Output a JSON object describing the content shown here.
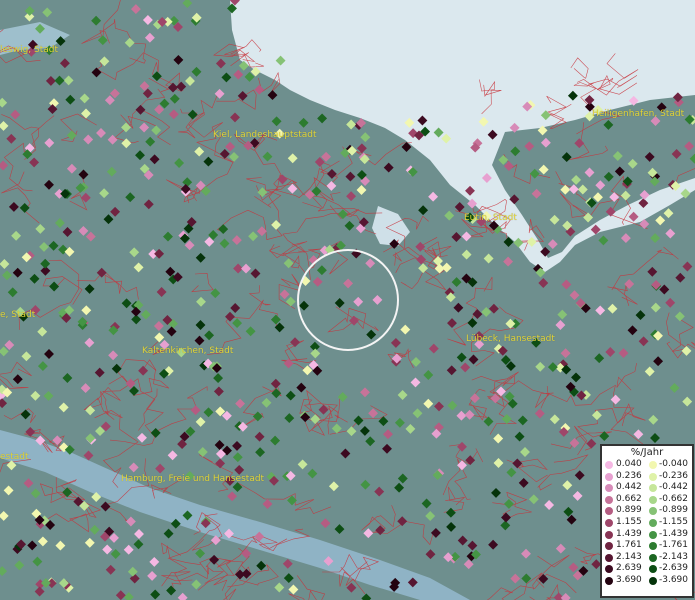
{
  "map": {
    "colors": {
      "land": "#6e8f8e",
      "water": "#dbe8ee",
      "river": "#8fb3c5",
      "borders": "#c8323a",
      "label": "#e0d43a"
    },
    "cities": [
      {
        "id": "schleswig",
        "name": "leswig, Stadt"
      },
      {
        "id": "kiel",
        "name": "Kiel, Landeshauptstadt"
      },
      {
        "id": "heiligenhafen",
        "name": "Heiligenhafen, Stadt"
      },
      {
        "id": "eutin",
        "name": "Eutin, Stadt"
      },
      {
        "id": "luebeck",
        "name": "Lübeck, Hansestadt"
      },
      {
        "id": "west",
        "name": "e, Stadt"
      },
      {
        "id": "kaltenkirchen",
        "name": "Kaltenkirchen, Stadt"
      },
      {
        "id": "stade",
        "name": "estadt"
      },
      {
        "id": "hamburg",
        "name": "Hamburg, Freie und Hansestadt"
      }
    ]
  },
  "legend": {
    "title": "%/Jahr",
    "rows": [
      {
        "pos": "0.040",
        "neg": "-0.040",
        "pc": "#f5b8e3",
        "nc": "#f2f7b0"
      },
      {
        "pos": "0.236",
        "neg": "-0.236",
        "pc": "#e7a0d0",
        "nc": "#dff2a8"
      },
      {
        "pos": "0.442",
        "neg": "-0.442",
        "pc": "#d78bb8",
        "nc": "#c6e69a"
      },
      {
        "pos": "0.662",
        "neg": "-0.662",
        "pc": "#c77399",
        "nc": "#a8d78a"
      },
      {
        "pos": "0.899",
        "neg": "-0.899",
        "pc": "#b55c82",
        "nc": "#86c275"
      },
      {
        "pos": "1.155",
        "neg": "-1.155",
        "pc": "#9f466a",
        "nc": "#63ab5c"
      },
      {
        "pos": "1.439",
        "neg": "-1.439",
        "pc": "#883454",
        "nc": "#449444"
      },
      {
        "pos": "1.761",
        "neg": "-1.761",
        "pc": "#702441",
        "nc": "#2d7c30"
      },
      {
        "pos": "2.143",
        "neg": "-2.143",
        "pc": "#561631",
        "nc": "#1c6622"
      },
      {
        "pos": "2.639",
        "neg": "-2.639",
        "pc": "#3c0a20",
        "nc": "#0d4e14"
      },
      {
        "pos": "3.690",
        "neg": "-3.690",
        "pc": "#240310",
        "nc": "#05330a"
      }
    ]
  }
}
